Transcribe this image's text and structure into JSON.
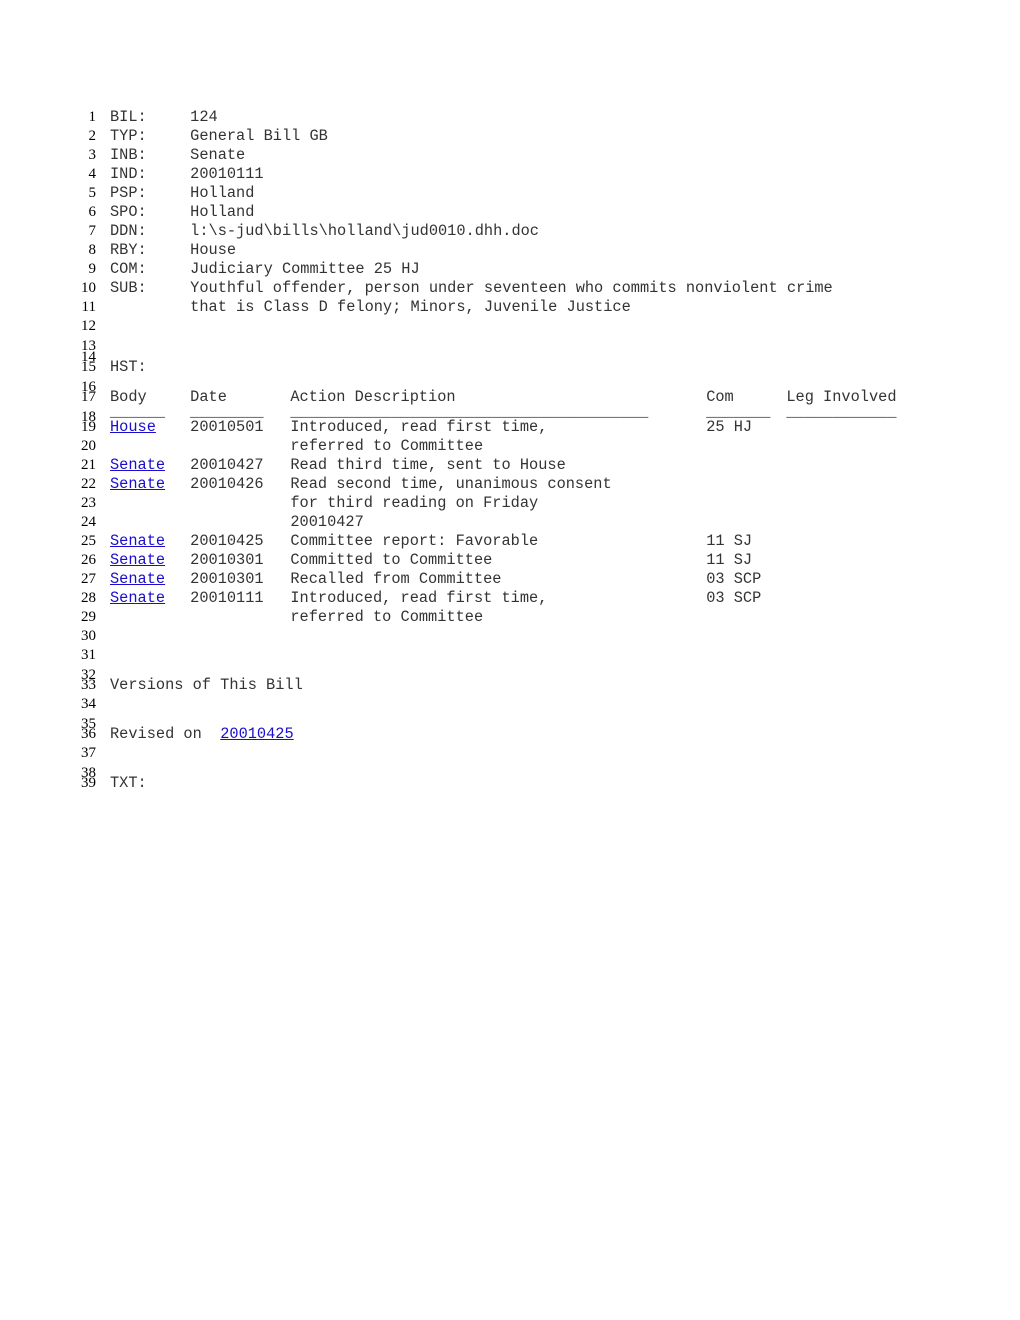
{
  "fields": [
    {
      "label": "BIL:",
      "value": "124"
    },
    {
      "label": "TYP:",
      "value": "General Bill GB"
    },
    {
      "label": "INB:",
      "value": "Senate"
    },
    {
      "label": "IND:",
      "value": "20010111"
    },
    {
      "label": "PSP:",
      "value": "Holland"
    },
    {
      "label": "SPO:",
      "value": "Holland"
    },
    {
      "label": "DDN:",
      "value": "l:\\s-jud\\bills\\holland\\jud0010.dhh.doc"
    },
    {
      "label": "RBY:",
      "value": "House"
    },
    {
      "label": "COM:",
      "value": "Judiciary Committee 25 HJ"
    },
    {
      "label": "SUB:",
      "value": "Youthful offender, person under seventeen who commits nonviolent crime"
    },
    {
      "label": "",
      "value": "that is Class D felony; Minors, Juvenile Justice"
    }
  ],
  "history_label": "HST:",
  "history_headers": {
    "body": "Body",
    "date": "Date",
    "action": "Action Description",
    "com": "Com",
    "leg": "Leg Involved"
  },
  "history_rules": {
    "body": "______",
    "date": "________",
    "action": "_______________________________________",
    "com": "_______",
    "leg": "____________"
  },
  "history": [
    {
      "body": "House",
      "date": "20010501",
      "action": [
        "Introduced, read first time,",
        "referred to Committee"
      ],
      "com": "25 HJ"
    },
    {
      "body": "Senate",
      "date": "20010427",
      "action": [
        "Read third time, sent to House"
      ],
      "com": ""
    },
    {
      "body": "Senate",
      "date": "20010426",
      "action": [
        "Read second time, unanimous consent",
        "for third reading on Friday",
        "20010427"
      ],
      "com": ""
    },
    {
      "body": "Senate",
      "date": "20010425",
      "action": [
        "Committee report: Favorable"
      ],
      "com": "11 SJ"
    },
    {
      "body": "Senate",
      "date": "20010301",
      "action": [
        "Committed to Committee"
      ],
      "com": "11 SJ"
    },
    {
      "body": "Senate",
      "date": "20010301",
      "action": [
        "Recalled from Committee"
      ],
      "com": "03 SCP"
    },
    {
      "body": "Senate",
      "date": "20010111",
      "action": [
        "Introduced, read first time,",
        "referred to Committee"
      ],
      "com": "03 SCP"
    }
  ],
  "versions_heading": "Versions of This Bill",
  "revised_prefix": "Revised on ",
  "revised_link": "20010425",
  "txt_label": "TXT:",
  "colors": {
    "link": "#1a0dcc",
    "text": "#333333"
  }
}
